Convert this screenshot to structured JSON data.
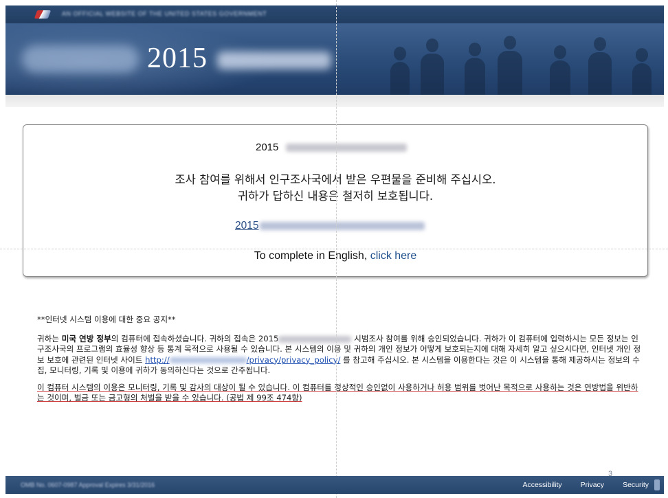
{
  "topbar": {
    "agency_text": "AN OFFICIAL WEBSITE OF THE UNITED STATES GOVERNMENT"
  },
  "banner": {
    "year": "2015"
  },
  "card": {
    "title_year": "2015",
    "line1": "조사 참여를 위해서 인구조사국에서 받은 우편물을 준비해 주십시오.",
    "line2": "귀하가 답하신 내용은 철저히 보호됩니다.",
    "korean_link_year": "2015",
    "english_prefix": "To complete in English,",
    "english_link": "click here"
  },
  "notice": {
    "heading": "**인터넷 시스템 이용에 대한 중요 공지**",
    "p1_start": "귀하는 ",
    "p1_bold": "미국 연방 정부",
    "p1_a": "의 컴퓨터에 접속하셨습니다. 귀하의 접속은 2015",
    "p1_b": " 시범조사 참여를 위해 승인되었습니다. 귀하가 이 컴퓨터에 입력하시는 모든 정보는 인구조사국의 프로그램의 효율성 향상 등 통계 목적으로 사용될 수 있습니다. 본 시스템의 이용 및 귀하의 개인 정보가 어떻게 보호되는지에 대해 자세히 알고 싶으시다면, 인터넷 개인 정보 보호에 관련된 인터넷 사이트",
    "url_prefix": "http://",
    "url_suffix": "/privacy/privacy_policy/",
    "p1_c": " 를 참고해 주십시오. 본 시스템을 이용한다는 것은 이 시스템을 통해 제공하시는 정보의 수집, 모니터링, 기록 및 이용에 귀하가 동의하신다는 것으로 간주됩니다.",
    "p2": "이 컴퓨터 시스템의 이용은 모니터링, 기록 및 감사의 대상이 될 수 있습니다. 이 컴퓨터를 정상적인 승인없이 사용하거나 허용 범위를 벗어난 목적으로 사용하는 것은 연방법을 위반하는 것이며, 벌금 또는 금고형의 처벌을 받을 수 있습니다. (공법 제 99조 474항)"
  },
  "footer": {
    "left_text": "OMB No. 0607-0987 Approval Expires 3/31/2016",
    "links": [
      "Accessibility",
      "Privacy",
      "Security"
    ],
    "page_number": "3"
  },
  "colors": {
    "banner": "#2a4b78",
    "link": "#1f4f8c",
    "footer": "#2f4f78"
  }
}
